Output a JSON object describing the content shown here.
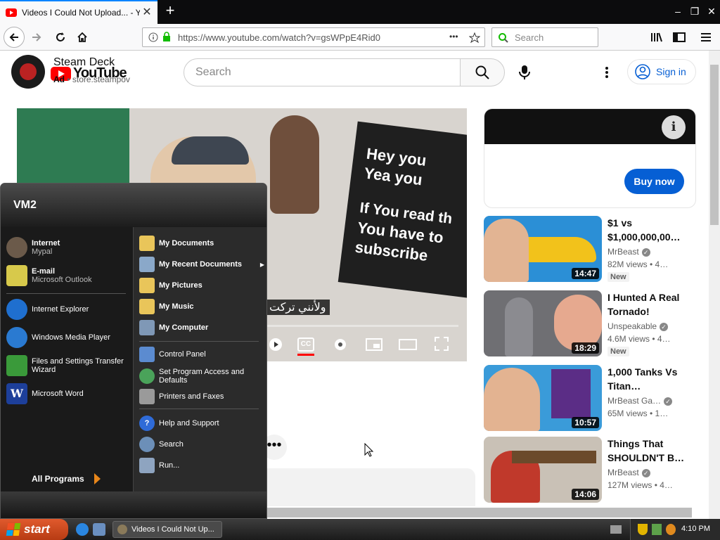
{
  "browser": {
    "tab_title": "Videos I Could Not Upload... - You",
    "tab_close": "✕",
    "new_tab": "+",
    "url": "https://www.youtube.com/watch?v=gsWPpE4Rid0",
    "url_more": "•••",
    "search_placeholder": "Search",
    "window_controls": [
      "–",
      "❐",
      "✕"
    ]
  },
  "youtube": {
    "logo_text": "YouTube",
    "search_placeholder": "Search",
    "sign_in": "Sign in",
    "video": {
      "sign_line1": "Hey you",
      "sign_line2": "Yea you",
      "sign_line3": "If You read th",
      "sign_line4": "You have to",
      "sign_line5": "subscribe",
      "caption": "ولأنني تركت",
      "cc_label": "CC"
    },
    "ad": {
      "info": "i",
      "title": "Steam Deck",
      "label": "Ad",
      "domain": "store.steampov",
      "button": "Buy now"
    },
    "recommendations": [
      {
        "title": "$1 vs $1,000,000,00…",
        "channel": "MrBeast",
        "meta": "82M views • 4…",
        "badge": "New",
        "duration": "14:47",
        "thumb_color": "#2b8fd6"
      },
      {
        "title": "I Hunted A Real Tornado!",
        "channel": "Unspeakable",
        "meta": "4.6M views • 4…",
        "badge": "New",
        "duration": "18:29",
        "thumb_color": "#6f6f73"
      },
      {
        "title": "1,000 Tanks Vs Titan…",
        "channel": "MrBeast Ga…",
        "meta": "65M views • 1…",
        "badge": "",
        "duration": "10:57",
        "thumb_color": "#3a9bd9"
      },
      {
        "title": "Things That SHOULDN'T B…",
        "channel": "MrBeast",
        "meta": "127M views • 4…",
        "badge": "",
        "duration": "14:06",
        "thumb_color": "#c9c1b6"
      }
    ],
    "more": "•••"
  },
  "start_menu": {
    "user": "VM2",
    "pinned": [
      {
        "title": "Internet",
        "sub": "Mypal"
      },
      {
        "title": "E-mail",
        "sub": "Microsoft Outlook"
      }
    ],
    "recent": [
      "Internet Explorer",
      "Windows Media Player",
      "Files and Settings Transfer Wizard",
      "Microsoft Word"
    ],
    "all_programs": "All Programs",
    "right_items": [
      "My Documents",
      "My Recent Documents",
      "My Pictures",
      "My Music",
      "My Computer",
      "Control Panel",
      "Set Program Access and Defaults",
      "Printers and Faxes",
      "Help and Support",
      "Search",
      "Run..."
    ]
  },
  "taskbar": {
    "start": "start",
    "task": "Videos I Could Not Up...",
    "clock": "4:10 PM"
  }
}
